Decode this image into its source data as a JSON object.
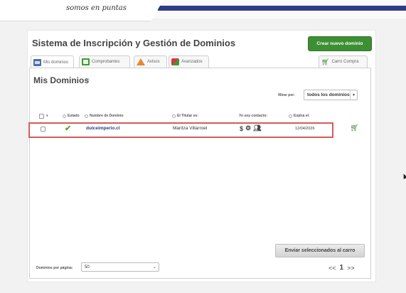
{
  "header": {
    "slogan": "somos en puntas"
  },
  "page": {
    "title": "Sistema de Inscripción y Gestión de Dominios",
    "new_domain_button": "Crear nuevo dominio"
  },
  "tabs": [
    {
      "label": "Mis dominios",
      "icon": "domains-icon"
    },
    {
      "label": "Comprobantes",
      "icon": "receipts-icon"
    },
    {
      "label": "Avisos",
      "icon": "warning-icon"
    },
    {
      "label": "Avanzados",
      "icon": "tools-icon"
    },
    {
      "label": "Carro Compra",
      "icon": "cart-icon"
    }
  ],
  "section": {
    "title": "Mis Dominios",
    "help": "(?)"
  },
  "filter": {
    "label": "filtrar por:",
    "value": "todos los dominios"
  },
  "table": {
    "columns": {
      "select_dropdown": "▾",
      "status": "Estado",
      "domain": "Nombre de Dominio",
      "holder": "El Titular es:",
      "contact": "Yo soy contacto:",
      "expires": "Expira el:"
    },
    "rows": [
      {
        "status_icon": "check-icon",
        "domain": "dulceimperio.cl",
        "holder": "Maritza Villarroel",
        "contact_icons": [
          "dollar-icon",
          "gear-icon",
          "people-icon"
        ],
        "expires": "12/04/2026",
        "action_icon": "cart-icon"
      }
    ]
  },
  "actions": {
    "send_to_cart": "Enviar seleccionados al carro"
  },
  "pagination": {
    "per_page_label": "Dominios por página:",
    "per_page_value": "50",
    "prev": "<<",
    "current": "1",
    "next": ">>"
  },
  "colors": {
    "brand_navy": "#2e3a87",
    "accent_green": "#3d8f34",
    "highlight_red": "#d65a5a"
  }
}
